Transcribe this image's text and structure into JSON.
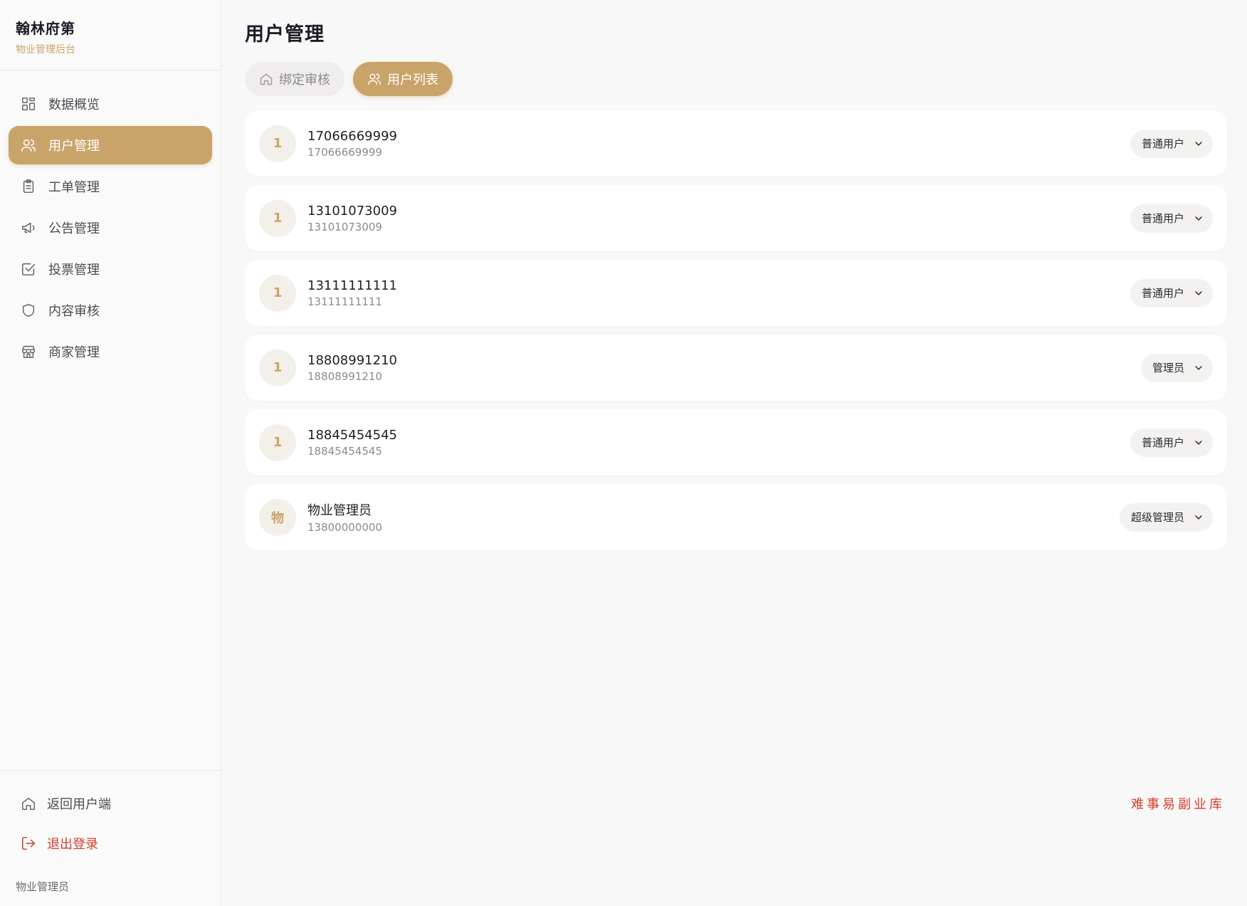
{
  "brand": {
    "title": "翰林府第",
    "subtitle": "物业管理后台"
  },
  "colors": {
    "accent": "#c9a46a",
    "danger": "#d1402f",
    "watermark": "#d3402c"
  },
  "sidebar": {
    "items": [
      {
        "label": "数据概览",
        "icon": "dashboard-icon",
        "active": false
      },
      {
        "label": "用户管理",
        "icon": "users-icon",
        "active": true
      },
      {
        "label": "工单管理",
        "icon": "clipboard-icon",
        "active": false
      },
      {
        "label": "公告管理",
        "icon": "megaphone-icon",
        "active": false
      },
      {
        "label": "投票管理",
        "icon": "checkbox-icon",
        "active": false
      },
      {
        "label": "内容审核",
        "icon": "shield-icon",
        "active": false
      },
      {
        "label": "商家管理",
        "icon": "store-icon",
        "active": false
      }
    ],
    "back_label": "返回用户端",
    "logout_label": "退出登录",
    "current_user": "物业管理员"
  },
  "main": {
    "title": "用户管理",
    "tabs": [
      {
        "label": "绑定审核",
        "icon": "home-icon",
        "active": false
      },
      {
        "label": "用户列表",
        "icon": "users-icon",
        "active": true
      }
    ],
    "users": [
      {
        "avatar": "1",
        "name": "17066669999",
        "phone": "17066669999",
        "role": "普通用户"
      },
      {
        "avatar": "1",
        "name": "13101073009",
        "phone": "13101073009",
        "role": "普通用户"
      },
      {
        "avatar": "1",
        "name": "13111111111",
        "phone": "13111111111",
        "role": "普通用户"
      },
      {
        "avatar": "1",
        "name": "18808991210",
        "phone": "18808991210",
        "role": "管理员"
      },
      {
        "avatar": "1",
        "name": "18845454545",
        "phone": "18845454545",
        "role": "普通用户"
      },
      {
        "avatar": "物",
        "name": "物业管理员",
        "phone": "13800000000",
        "role": "超级管理员"
      }
    ]
  },
  "watermark": "难事易副业库"
}
